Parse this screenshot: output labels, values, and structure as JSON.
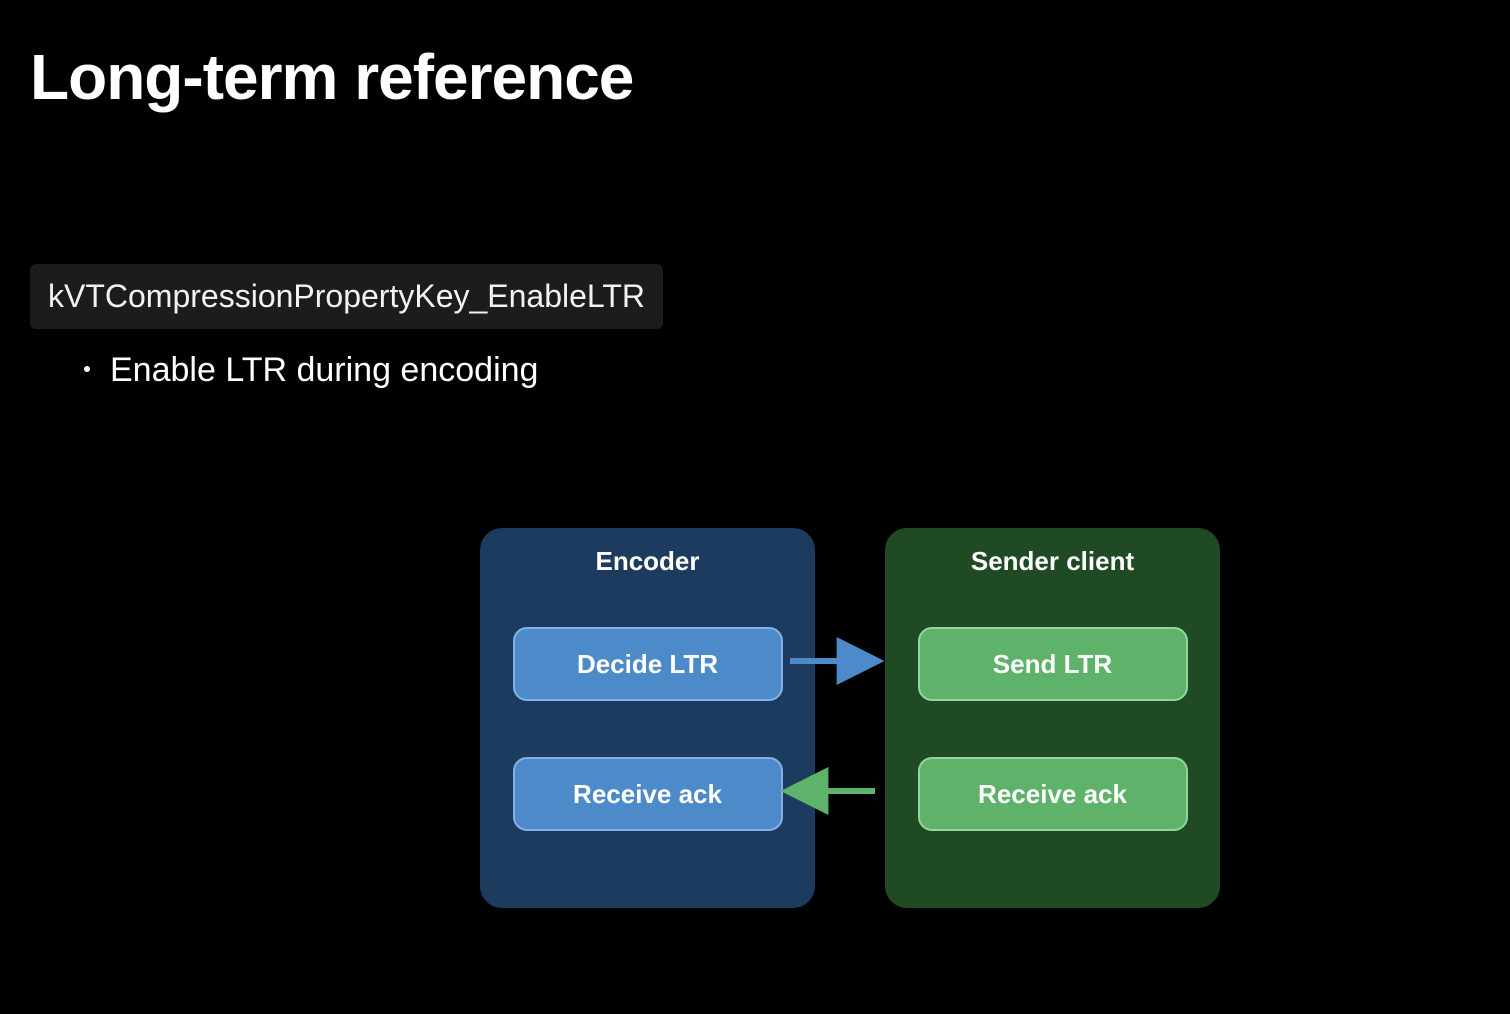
{
  "title": "Long-term reference",
  "code_chip": "kVTCompressionPropertyKey_EnableLTR",
  "bullet": "Enable LTR during encoding",
  "diagram": {
    "encoder": {
      "title": "Encoder",
      "box1": "Decide LTR",
      "box2": "Receive ack"
    },
    "sender": {
      "title": "Sender client",
      "box1": "Send LTR",
      "box2": "Receive ack"
    },
    "arrow1": {
      "from": "encoder.box1",
      "to": "sender.box1",
      "direction": "right",
      "color": "#4d8ac9"
    },
    "arrow2": {
      "from": "sender.box2",
      "to": "encoder.box2",
      "direction": "left",
      "color": "#5fb26a"
    }
  }
}
